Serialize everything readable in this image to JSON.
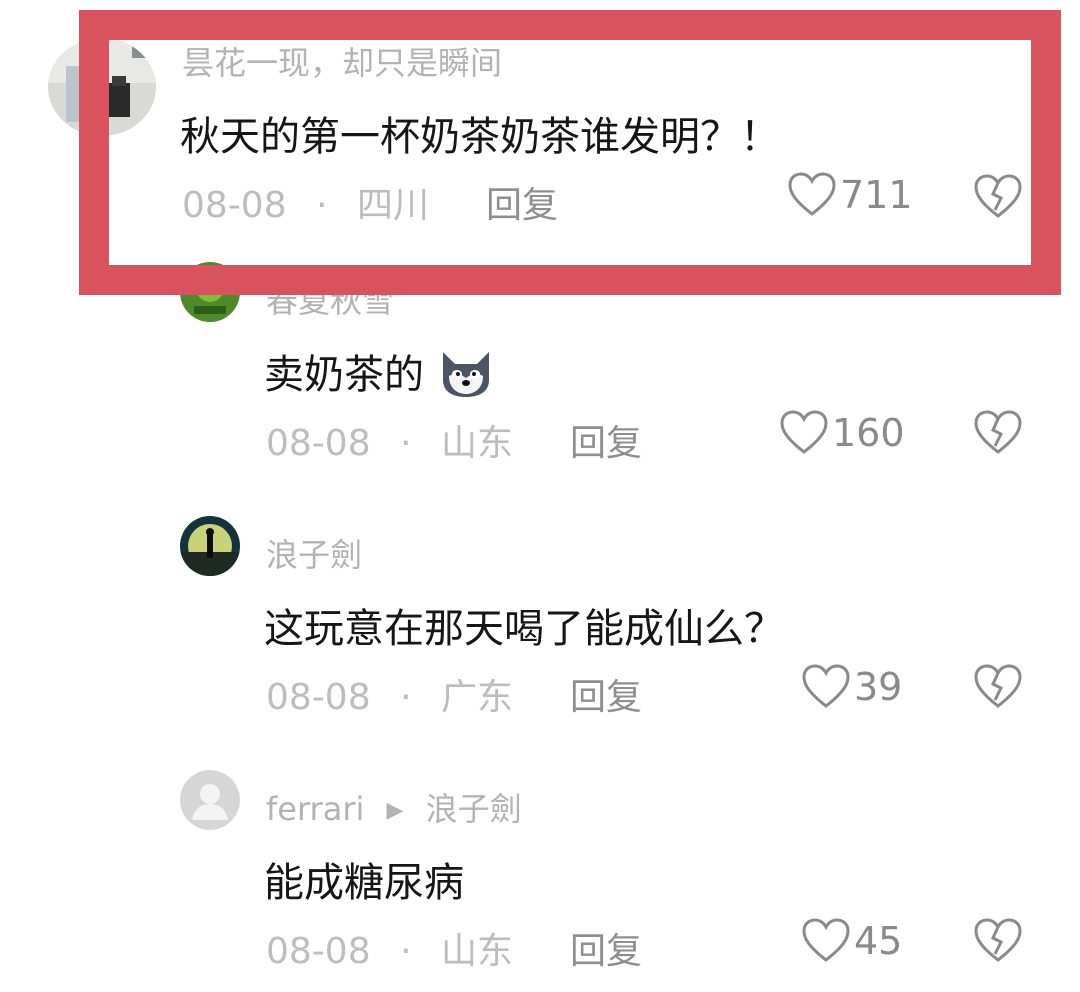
{
  "comments": [
    {
      "username": "昙花一现，却只是瞬间",
      "text": "秋天的第一杯奶茶奶茶谁发明？！",
      "date": "08-08",
      "location": "四川",
      "reply_label": "回复",
      "likes": "711"
    },
    {
      "username": "春夏秋雪",
      "text": "卖奶茶的",
      "emoji": "dog-emoji",
      "date": "08-08",
      "location": "山东",
      "reply_label": "回复",
      "likes": "160"
    },
    {
      "username": "浪子劍",
      "text": "这玩意在那天喝了能成仙么？",
      "date": "08-08",
      "location": "广东",
      "reply_label": "回复",
      "likes": "39"
    },
    {
      "username": "ferrari",
      "reply_to": "浪子劍",
      "text": "能成糖尿病",
      "date": "08-08",
      "location": "山东",
      "reply_label": "回复",
      "likes": "45"
    }
  ],
  "dot": "·",
  "colors": {
    "highlight": "#d8535d",
    "muted": "#b3b3b3",
    "text": "#161616"
  },
  "icons": [
    "like-heart-icon",
    "broken-heart-icon",
    "default-avatar-icon"
  ]
}
